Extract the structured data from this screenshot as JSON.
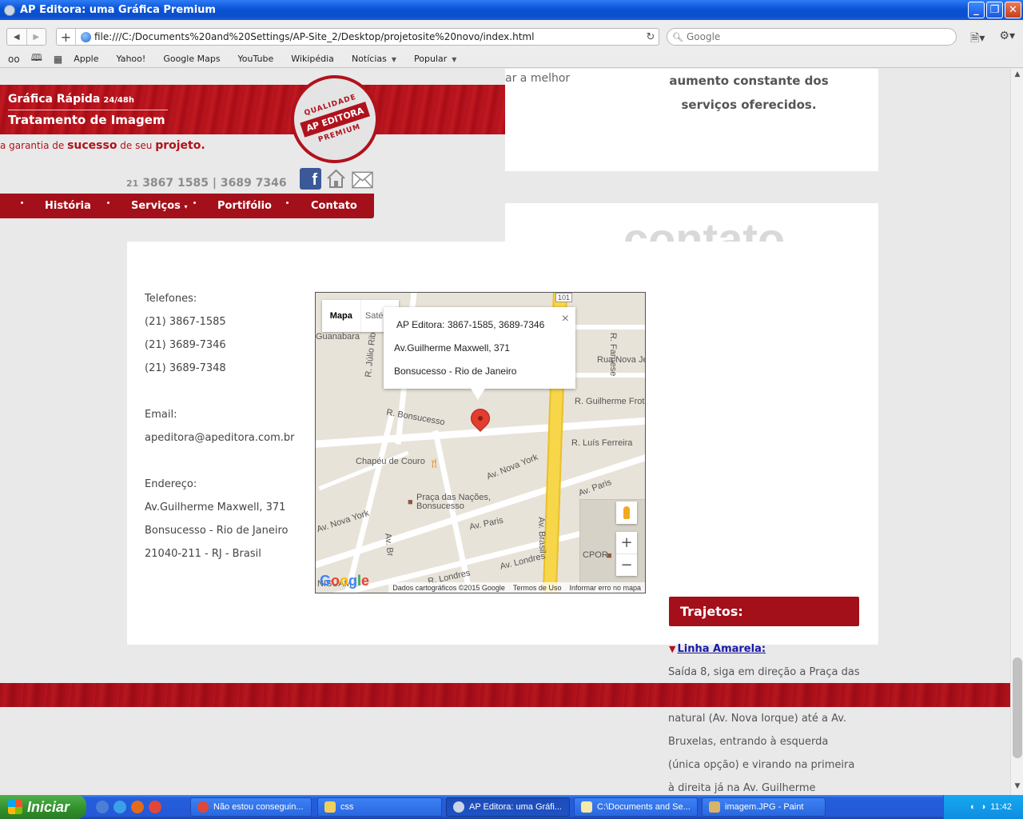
{
  "window": {
    "title": "AP Editora: uma Gráfica Premium",
    "buttons": {
      "minimize": "_",
      "maximize": "❐",
      "close": "✕"
    }
  },
  "toolbar": {
    "back": "◀",
    "forward": "▶",
    "new_tab": "+",
    "url": "file:///C:/Documents%20and%20Settings/AP-Site_2/Desktop/projetosite%20novo/index.html",
    "reload": "↻",
    "search_placeholder": "Google",
    "search_icon": "magnifier-icon",
    "page_menu_icon": "page-icon",
    "settings_icon": "gear-icon"
  },
  "bookmarks": {
    "items": [
      "Apple",
      "Yahoo!",
      "Google Maps",
      "YouTube",
      "Wikipédia",
      "Notícias",
      "Popular"
    ]
  },
  "page": {
    "top_text_left": "ar a melhor",
    "top_text_right_1": "aumento constante dos",
    "top_text_right_2": "serviços oferecidos.",
    "header": {
      "line1": "Gráfica Rápida",
      "line1_small": "24/48h",
      "line2": "Tratamento de Imagem",
      "tagline_pre": "a garantia de",
      "tagline_bold": "sucesso",
      "tagline_mid": "de seu",
      "tagline_bold2": "projeto.",
      "seal_top": "QUALIDADE",
      "seal_mid": "AP EDITORA",
      "seal_bottom": "PREMIUM",
      "phone_prefix": "21",
      "phones": "3867 1585 | 3689 7346"
    },
    "nav": [
      "História",
      "Serviços",
      "Portifólio",
      "Contato"
    ],
    "contato_title": "contato",
    "contact": {
      "telefones_label": "Telefones:",
      "phones": [
        "(21) 3867-1585",
        "(21) 3689-7346",
        "(21) 3689-7348"
      ],
      "email_label": "Email:",
      "email": "apeditora@apeditora.com.br",
      "endereco_label": "Endereço:",
      "address": [
        "Av.Guilherme Maxwell, 371",
        "Bonsucesso - Rio de Janeiro",
        "21040-211 - RJ - Brasil"
      ]
    },
    "map": {
      "tab_map": "Mapa",
      "tab_satellite": "Satélite",
      "info_lines": [
        "AP Editora: 3867-1585, 3689-7346",
        "Av.Guilherme Maxwell, 371",
        "Bonsucesso - Rio de Janeiro"
      ],
      "close": "×",
      "labels": {
        "guanabara": "Guanabara",
        "julio": "R. Júlio Ribeiro",
        "bonsucesso": "R. Bonsucesso",
        "chapeu": "Chapéu de Couro",
        "nova_york_1": "Av. Nova York",
        "nova_york_2": "Av. Nova York",
        "praca": "Praça das Nações,",
        "praca2": "Bonsucesso",
        "paris_1": "Av. Paris",
        "paris_2": "Av. Paris",
        "brasil": "Av. Brasil",
        "londres_1": "Av. Londres",
        "londres_2": "R. Londres",
        "luis": "R. Luís Ferreira",
        "guilherme": "R. Guilherme Frot",
        "nova_jerusa": "Rua Nova Jerusa",
        "farnese": "R. Farnese",
        "cpor": "CPOR",
        "nisuam": "NISUAM",
        "av_br": "Av. Br",
        "route_101": "101"
      },
      "zoom_in": "+",
      "zoom_out": "−",
      "logo": "Google",
      "footer": [
        "Dados cartográficos ©2015 Google",
        "Termos de Uso",
        "Informar erro no mapa"
      ]
    },
    "trajetos_title": "Trajetos:",
    "linha_label": "Linha Amarela:",
    "route_lines": [
      "Saída 8, siga em direção a Praça das",
      "natural (Av. Nova Iorque) até a Av.",
      "Bruxelas, entrando à esquerda",
      "(única opção) e virando na primeira",
      "à direita já na Av. Guilherme"
    ]
  },
  "taskbar": {
    "start": "Iniciar",
    "tasks": [
      "Não estou conseguin...",
      "css",
      "AP Editora: uma Gráfi...",
      "C:\\Documents and Se...",
      "imagem.JPG - Paint"
    ],
    "clock": "11:42"
  },
  "colors": {
    "brand_red": "#a3101a",
    "link_blue": "#1a1aa6",
    "contato_grey": "#d9d9d9"
  }
}
